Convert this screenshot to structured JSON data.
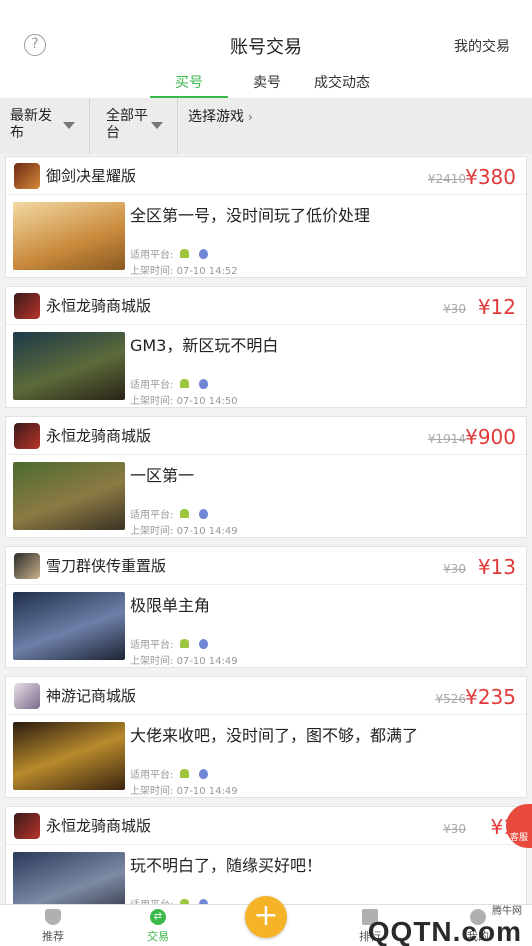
{
  "header": {
    "title": "账号交易",
    "my_trades": "我的交易"
  },
  "tabs": [
    "买号",
    "卖号",
    "成交动态"
  ],
  "filters": {
    "latest": "最新发布",
    "platform": "全部平台",
    "choose_game": "选择游戏"
  },
  "labels": {
    "platform": "适用平台:",
    "listed_time_prefix": "上架时间: "
  },
  "listings": [
    {
      "game": "御剑决星耀版",
      "old_price": "¥2410",
      "price": "¥380",
      "desc": "全区第一号，没时间玩了低价处理",
      "time": "07-10 14:52"
    },
    {
      "game": "永恒龙骑商城版",
      "old_price": "¥30",
      "price": "¥12",
      "desc": "GM3，新区玩不明白",
      "time": "07-10 14:50"
    },
    {
      "game": "永恒龙骑商城版",
      "old_price": "¥1914",
      "price": "¥900",
      "desc": "一区第一",
      "time": "07-10 14:49"
    },
    {
      "game": "雪刀群侠传重置版",
      "old_price": "¥30",
      "price": "¥13",
      "desc": "极限单主角",
      "time": "07-10 14:49"
    },
    {
      "game": "神游记商城版",
      "old_price": "¥526",
      "price": "¥235",
      "desc": "大佬来收吧，没时间了，图不够，都满了",
      "time": "07-10 14:49"
    },
    {
      "game": "永恒龙骑商城版",
      "old_price": "¥30",
      "price": "¥1",
      "desc": "玩不明白了，随缘买好吧！",
      "time": ""
    }
  ],
  "customer_service": "客服",
  "bottom_nav": {
    "recommend": "推荐",
    "trade": "交易",
    "rank": "排行",
    "mine": "我的"
  },
  "watermark": {
    "top": "腾牛网",
    "main": "QQTN.com"
  },
  "colors": {
    "accent": "#3cb94b",
    "price": "#e03a3a",
    "fab": "#f6b328"
  }
}
